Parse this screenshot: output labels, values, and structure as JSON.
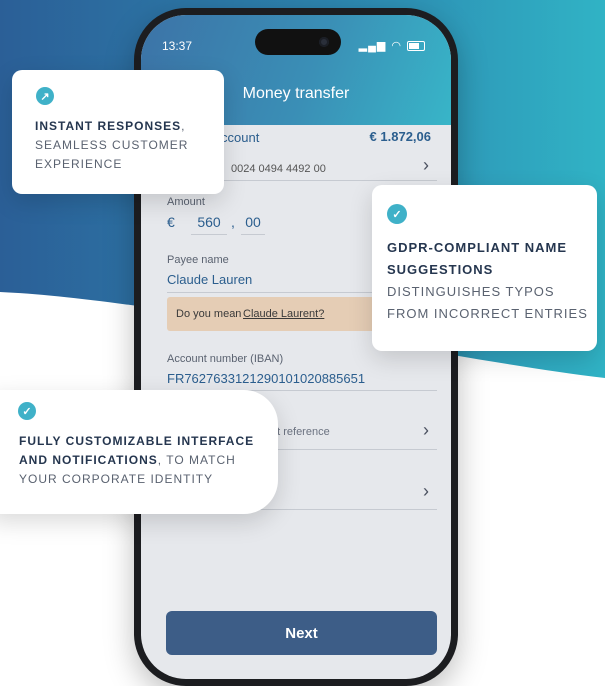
{
  "colors": {
    "teal_blue": "#2f74a6",
    "accent": "#3fb1c8",
    "button": "#3d5d87",
    "suggestion_bg": "#e5cdb5"
  },
  "phone": {
    "status_time": "13:37",
    "title": "Money transfer",
    "from_account": {
      "label_fragment": "ccount",
      "balance": "€ 1.872,06",
      "number_fragment": "0024 0494 4492 00"
    },
    "amount": {
      "label_fragment": "Amount",
      "currency": "€",
      "whole": "560",
      "separator": ",",
      "cents": "00"
    },
    "payee": {
      "label": "Payee name",
      "value": "Claude Lauren",
      "suggestion_prefix": "Do you mean",
      "suggestion_name": "Claude Laurent?"
    },
    "iban": {
      "label": "Account number (IBAN)",
      "value": "FR7627633121290101020885651"
    },
    "reference": {
      "label_fragment": "nt reference"
    },
    "next_label": "Next"
  },
  "cards": {
    "instant": {
      "icon": "arrow-up-right-icon",
      "bold": "INSTANT RESPONSES",
      "rest_1": ",",
      "line_2": "SEAMLESS CUSTOMER",
      "line_3": "EXPERIENCE"
    },
    "gdpr": {
      "icon": "check-icon",
      "bold_1": "GDPR-COMPLIANT NAME",
      "bold_2": "SUGGESTIONS",
      "line_3": "DISTINGUISHES TYPOS",
      "line_4": "FROM INCORRECT ENTRIES"
    },
    "custom": {
      "icon": "check-icon",
      "bold_1": "FULLY CUSTOMIZABLE INTERFACE",
      "bold_2": "AND NOTIFICATIONS",
      "rest_2": ", TO MATCH",
      "line_3": "YOUR CORPORATE IDENTITY"
    }
  }
}
